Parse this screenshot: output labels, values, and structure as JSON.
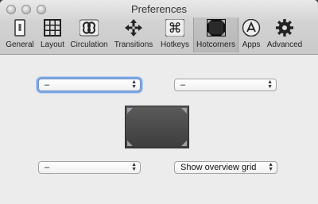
{
  "window": {
    "title": "Preferences"
  },
  "toolbar": {
    "items": [
      {
        "label": "General",
        "icon": "switch-icon"
      },
      {
        "label": "Layout",
        "icon": "grid-icon"
      },
      {
        "label": "Circulation",
        "icon": "infinity-loop-icon"
      },
      {
        "label": "Transitions",
        "icon": "move-arrows-icon"
      },
      {
        "label": "Hotkeys",
        "icon": "command-key-icon"
      },
      {
        "label": "Hotcorners",
        "icon": "screen-corners-icon",
        "selected": true
      },
      {
        "label": "Apps",
        "icon": "app-store-icon"
      },
      {
        "label": "Advanced",
        "icon": "gear-icon"
      }
    ]
  },
  "hotcorners": {
    "top_left": "–",
    "top_right": "–",
    "bottom_left": "–",
    "bottom_right": "Show overview grid"
  },
  "colors": {
    "focus_ring": "#7aa7e3",
    "screen": "#4a4a4a"
  }
}
